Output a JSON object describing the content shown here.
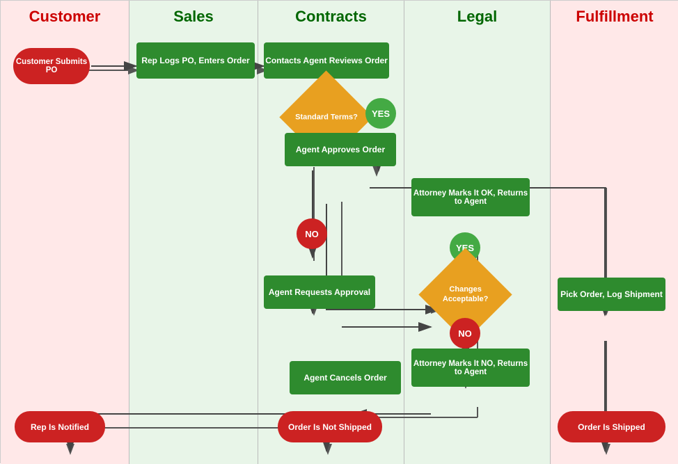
{
  "header": {
    "customer_label": "Customer",
    "sales_label": "Sales",
    "contracts_label": "Contracts",
    "legal_label": "Legal",
    "fulfillment_label": "Fulfillment"
  },
  "nodes": {
    "customer_submits_po": "Customer Submits PO",
    "rep_logs_po": "Rep Logs PO, Enters Order",
    "contacts_agent": "Contacts Agent Reviews Order",
    "standard_terms": "Standard Terms?",
    "yes1": "YES",
    "agent_approves": "Agent Approves Order",
    "attorney_marks_ok": "Attorney Marks It OK, Returns to Agent",
    "yes2": "YES",
    "changes_acceptable": "Changes Acceptable?",
    "no1": "NO",
    "agent_requests": "Agent Requests Approval",
    "no2": "NO",
    "pick_order": "Pick Order, Log Shipment",
    "attorney_marks_no": "Attorney Marks It NO, Returns to Agent",
    "agent_cancels": "Agent Cancels Order",
    "rep_notified": "Rep Is Notified",
    "order_not_shipped": "Order Is Not Shipped",
    "order_shipped": "Order Is Shipped"
  },
  "colors": {
    "green_box": "#2e8b2e",
    "red_oval": "#cc2222",
    "green_circle": "#44aa44",
    "diamond": "#e8a020",
    "customer_header": "#cc0000",
    "other_header": "#006600",
    "customer_bg": "#ffe8e8",
    "other_bg": "#e8f5e8"
  }
}
